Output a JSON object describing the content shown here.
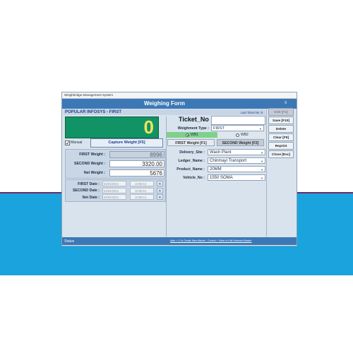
{
  "window": {
    "title": "Weighbridge Management System",
    "form_title": "Weighing Form",
    "form_number": "9"
  },
  "company": {
    "name": "POPULAR INFOSYS - FIRST",
    "last_ticket": "Last Ticket No: 8"
  },
  "display": {
    "value": "0"
  },
  "manual": {
    "label": "Manual",
    "checked": true
  },
  "capture": {
    "label": "Capture Weight [F5]"
  },
  "weights": {
    "first_label": "FIRST Weight :",
    "first_value": "8996",
    "second_label": "SECOND Weight :",
    "second_value": "3320.00",
    "net_label": "Net Weight :",
    "net_value": "5676"
  },
  "dates": [
    {
      "label": "FIRST Date :",
      "date": "04/04/2024",
      "time": "10:58:13",
      "btn": "R"
    },
    {
      "label": "SECOND Date :",
      "date": "04/04/2024",
      "time": "10:58:51",
      "btn": "R"
    },
    {
      "label": "Net Date :",
      "date": "04/04/2024",
      "time": "10:59:13",
      "btn": "R"
    }
  ],
  "ticket": {
    "label": "Ticket_No",
    "value": ""
  },
  "weighment_type": {
    "label": "Weighment Type :",
    "value": "FIRST"
  },
  "bridges": {
    "wb1": "WB1",
    "wb2": "WB2",
    "selected": "WB1"
  },
  "tabs": {
    "first": "FIRST Weight [F1]",
    "second": "SECOND Weight [F2]"
  },
  "fields": [
    {
      "label": "Delivery_Site :",
      "value": "Wash Plant"
    },
    {
      "label": "Ledger_Name :",
      "value": "Chinmayi Transport"
    },
    {
      "label": "Product_Name :",
      "value": "20MM"
    },
    {
      "label": "Vehicle_No :",
      "value": "1550 SOMA"
    }
  ],
  "side_buttons": {
    "edit": "Edit [F4]",
    "save": "Save [F10]",
    "delete": "Delete",
    "clear": "Clear [F9]",
    "reprint": "Reprint",
    "close": "Close [Esc]"
  },
  "status": {
    "label": "Status",
    "hint": "Alter + C to Create New Master , Control + Enter to Edit Selected Master"
  },
  "colors": {
    "title_bar": "#3c78b5",
    "display_bg": "#119366",
    "display_digit": "#f3e35a",
    "highlight": "#7fd18a",
    "background_band": "#1aa3dd"
  }
}
